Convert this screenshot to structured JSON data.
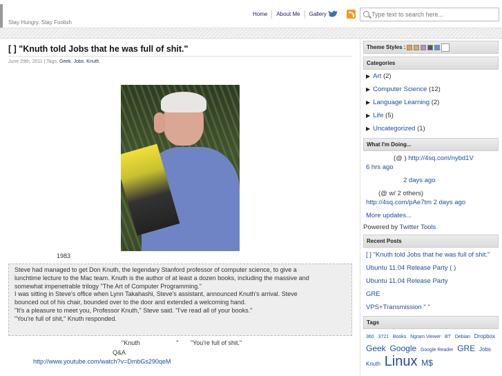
{
  "header": {
    "tagline": "Stay Hungry. Stay Foolish",
    "nav": [
      "Home",
      "About Me",
      "Gallery"
    ],
    "search_placeholder": "Type text to search here..."
  },
  "post": {
    "title": "[       ]  \"Knuth told Jobs that he was full of shit.\"",
    "date": "June 29th, 2011 | Tags: ",
    "tags": [
      "Geek",
      "Jobs",
      "Knuth"
    ],
    "caption_year": "1983",
    "quote_lines": [
      "Steve had managed to get Don Knuth, the legendary Stanford professor of computer science, to give a",
      "lunchtime lecture to the Mac team. Knuth is the author of at least a dozen books, including the massive and",
      "somewhat impenetrable trilogy \"The Art of Computer Programming.\"",
      "I was sitting in Steve's office when Lynn Takahashi, Steve's assistant, announced Knuth's arrival. Steve",
      "bounced out of his chair, bounded over to the door and extended a welcoming hand.",
      "\"It's a pleasure to meet you, Professor Knuth,\" Steve said. \"I've read all of your books.\"",
      "\"You're full of shit,\" Knuth responded."
    ],
    "line_a": "\"Knuth                     \"       \"You're full of shit.\"",
    "line_b": "Q&A",
    "video_link": "http://www.youtube.com/watch?v=DmbGs290qeM"
  },
  "sidebar": {
    "theme_label": "Theme Styles :",
    "theme_colors": [
      "#e9a13b",
      "#c8b070",
      "#b48fbf",
      "#555555",
      "#5c8fd8"
    ],
    "categories_title": "Categories",
    "categories": [
      {
        "name": "Art",
        "count": "(2)"
      },
      {
        "name": "Computer Science",
        "count": "(12)"
      },
      {
        "name": "Language Learning",
        "count": "(2)"
      },
      {
        "name": "Life",
        "count": "(5)"
      },
      {
        "name": "Uncategorized",
        "count": "(1)"
      }
    ],
    "doing_title": "What I'm Doing...",
    "doing": {
      "l1": "(@          )",
      "l1_link": "http://4sq.com/nybd1V",
      "l2": "6 hrs ago",
      "l3": "2 days ago",
      "l4": "(@          w/ 2 others)",
      "l5_link": "http://4sq.com/pAe7tm",
      "l5_time": "2 days ago",
      "more": "More updates...",
      "powered": "Powered by ",
      "powered_link": "Twitter Tools"
    },
    "recent_title": "Recent Posts",
    "recent": [
      "[      ]  \"Knuth told Jobs that he was full of shit.\"",
      "Ubuntu 11.04 Release Party          (      )",
      "Ubuntu 11.04 Release Party",
      "GRE",
      "VPS+Transmission   \"      \""
    ],
    "tags_title": "Tags",
    "tags": [
      {
        "t": "360",
        "s": 7
      },
      {
        "t": "3721",
        "s": 7
      },
      {
        "t": "Books",
        "s": 7
      },
      {
        "t": "Ngram Viewer",
        "s": 7
      },
      {
        "t": "BT",
        "s": 7
      },
      {
        "t": "Debian",
        "s": 7
      },
      {
        "t": "Dropbox",
        "s": 8
      },
      {
        "t": "Geek",
        "s": 12
      },
      {
        "t": "Google",
        "s": 12
      },
      {
        "t": "Google Reader",
        "s": 7
      },
      {
        "t": "GRE",
        "s": 12
      },
      {
        "t": "Jobs",
        "s": 8
      },
      {
        "t": "Knuth",
        "s": 8
      },
      {
        "t": "Linux",
        "s": 20
      },
      {
        "t": "M$",
        "s": 12
      }
    ]
  }
}
